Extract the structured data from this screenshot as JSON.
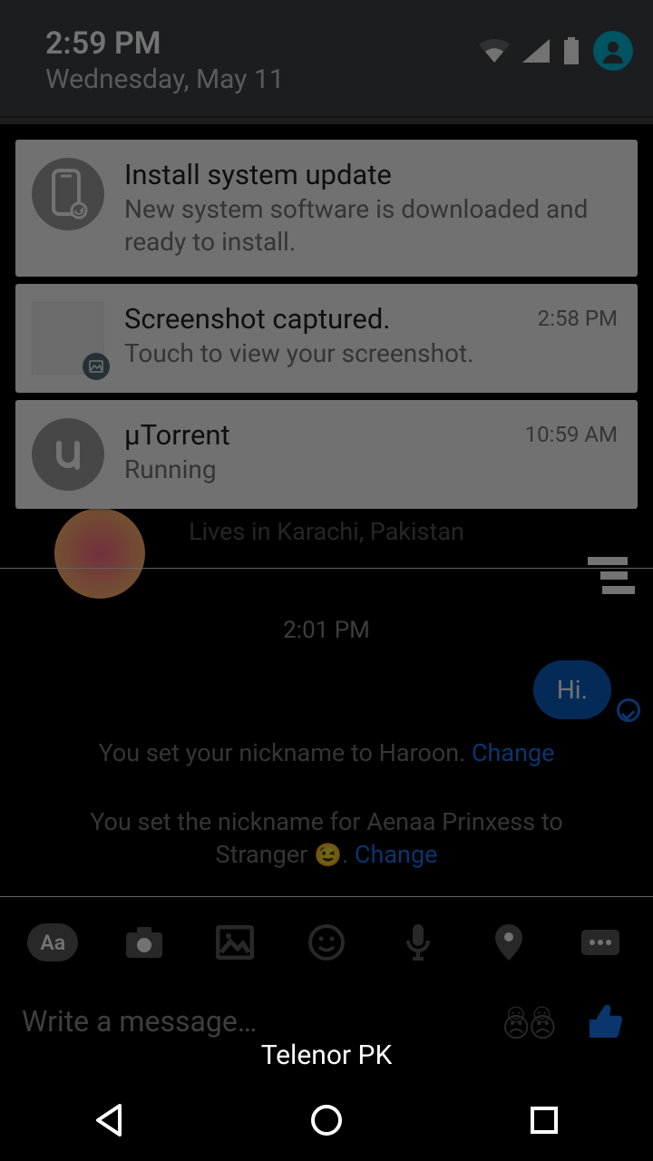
{
  "shade": {
    "time": "2:59 PM",
    "date": "Wednesday, May 11"
  },
  "notifications": [
    {
      "title": "Install system update",
      "sub": "New system software is downloaded and ready to install.",
      "time": ""
    },
    {
      "title": "Screenshot captured.",
      "sub": "Touch to view your screenshot.",
      "time": "2:58 PM"
    },
    {
      "title": "µTorrent",
      "sub": "Running",
      "time": "10:59 AM"
    }
  ],
  "chat": {
    "location": "Lives in Karachi, Pakistan",
    "centerTime": "2:01 PM",
    "outText": "Hi.",
    "sys1_pre": "You set your nickname to Haroon. ",
    "sys1_link": "Change",
    "sys2_pre": "You set the nickname for Aenaa Prinxess to Stranger ",
    "sys2_emoji": "😉",
    "sys2_post": ". ",
    "sys2_link": "Change"
  },
  "compose": {
    "placeholder": "Write a message…"
  },
  "toolbar": {
    "aa": "Aa"
  },
  "carrier": "Telenor PK"
}
